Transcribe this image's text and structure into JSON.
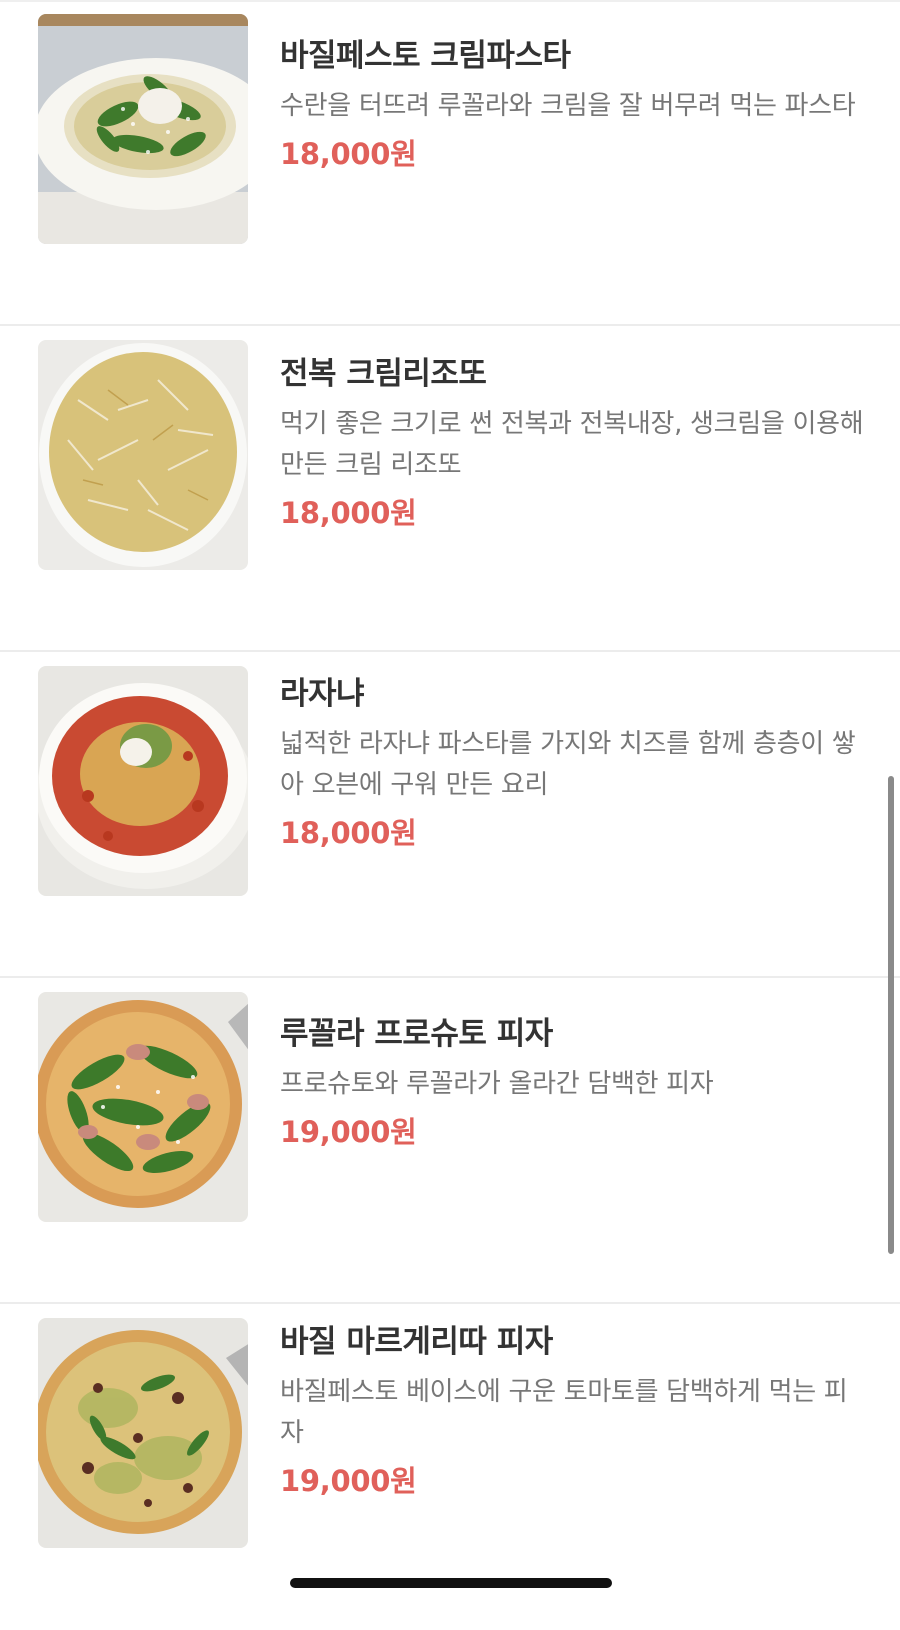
{
  "menu": {
    "items": [
      {
        "name": "바질페스토 크림파스타",
        "description": "수란을 터뜨려 루꼴라와 크림을 잘 버무려 먹는 파스타",
        "price": "18,000원",
        "image_icon": "pasta-dish-image"
      },
      {
        "name": "전복 크림리조또",
        "description": "먹기 좋은 크기로 썬 전복과 전복내장, 생크림을 이용해 만든 크림 리조또",
        "price": "18,000원",
        "image_icon": "risotto-dish-image"
      },
      {
        "name": "라자냐",
        "description": "넓적한 라자냐 파스타를 가지와 치즈를 함께 층층이 쌓아 오븐에 구워 만든 요리",
        "price": "18,000원",
        "image_icon": "lasagna-dish-image"
      },
      {
        "name": "루꼴라 프로슈토 피자",
        "description": "프로슈토와 루꼴라가 올라간 담백한 피자",
        "price": "19,000원",
        "image_icon": "pizza-image"
      },
      {
        "name": "바질 마르게리따 피자",
        "description": "바질페스토 베이스에 구운 토마토를 담백하게 먹는 피자",
        "price": "19,000원",
        "image_icon": "pizza-image"
      }
    ]
  },
  "colors": {
    "price": "#e0605a",
    "title": "#333333",
    "description": "#777777",
    "divider": "#ececec"
  }
}
